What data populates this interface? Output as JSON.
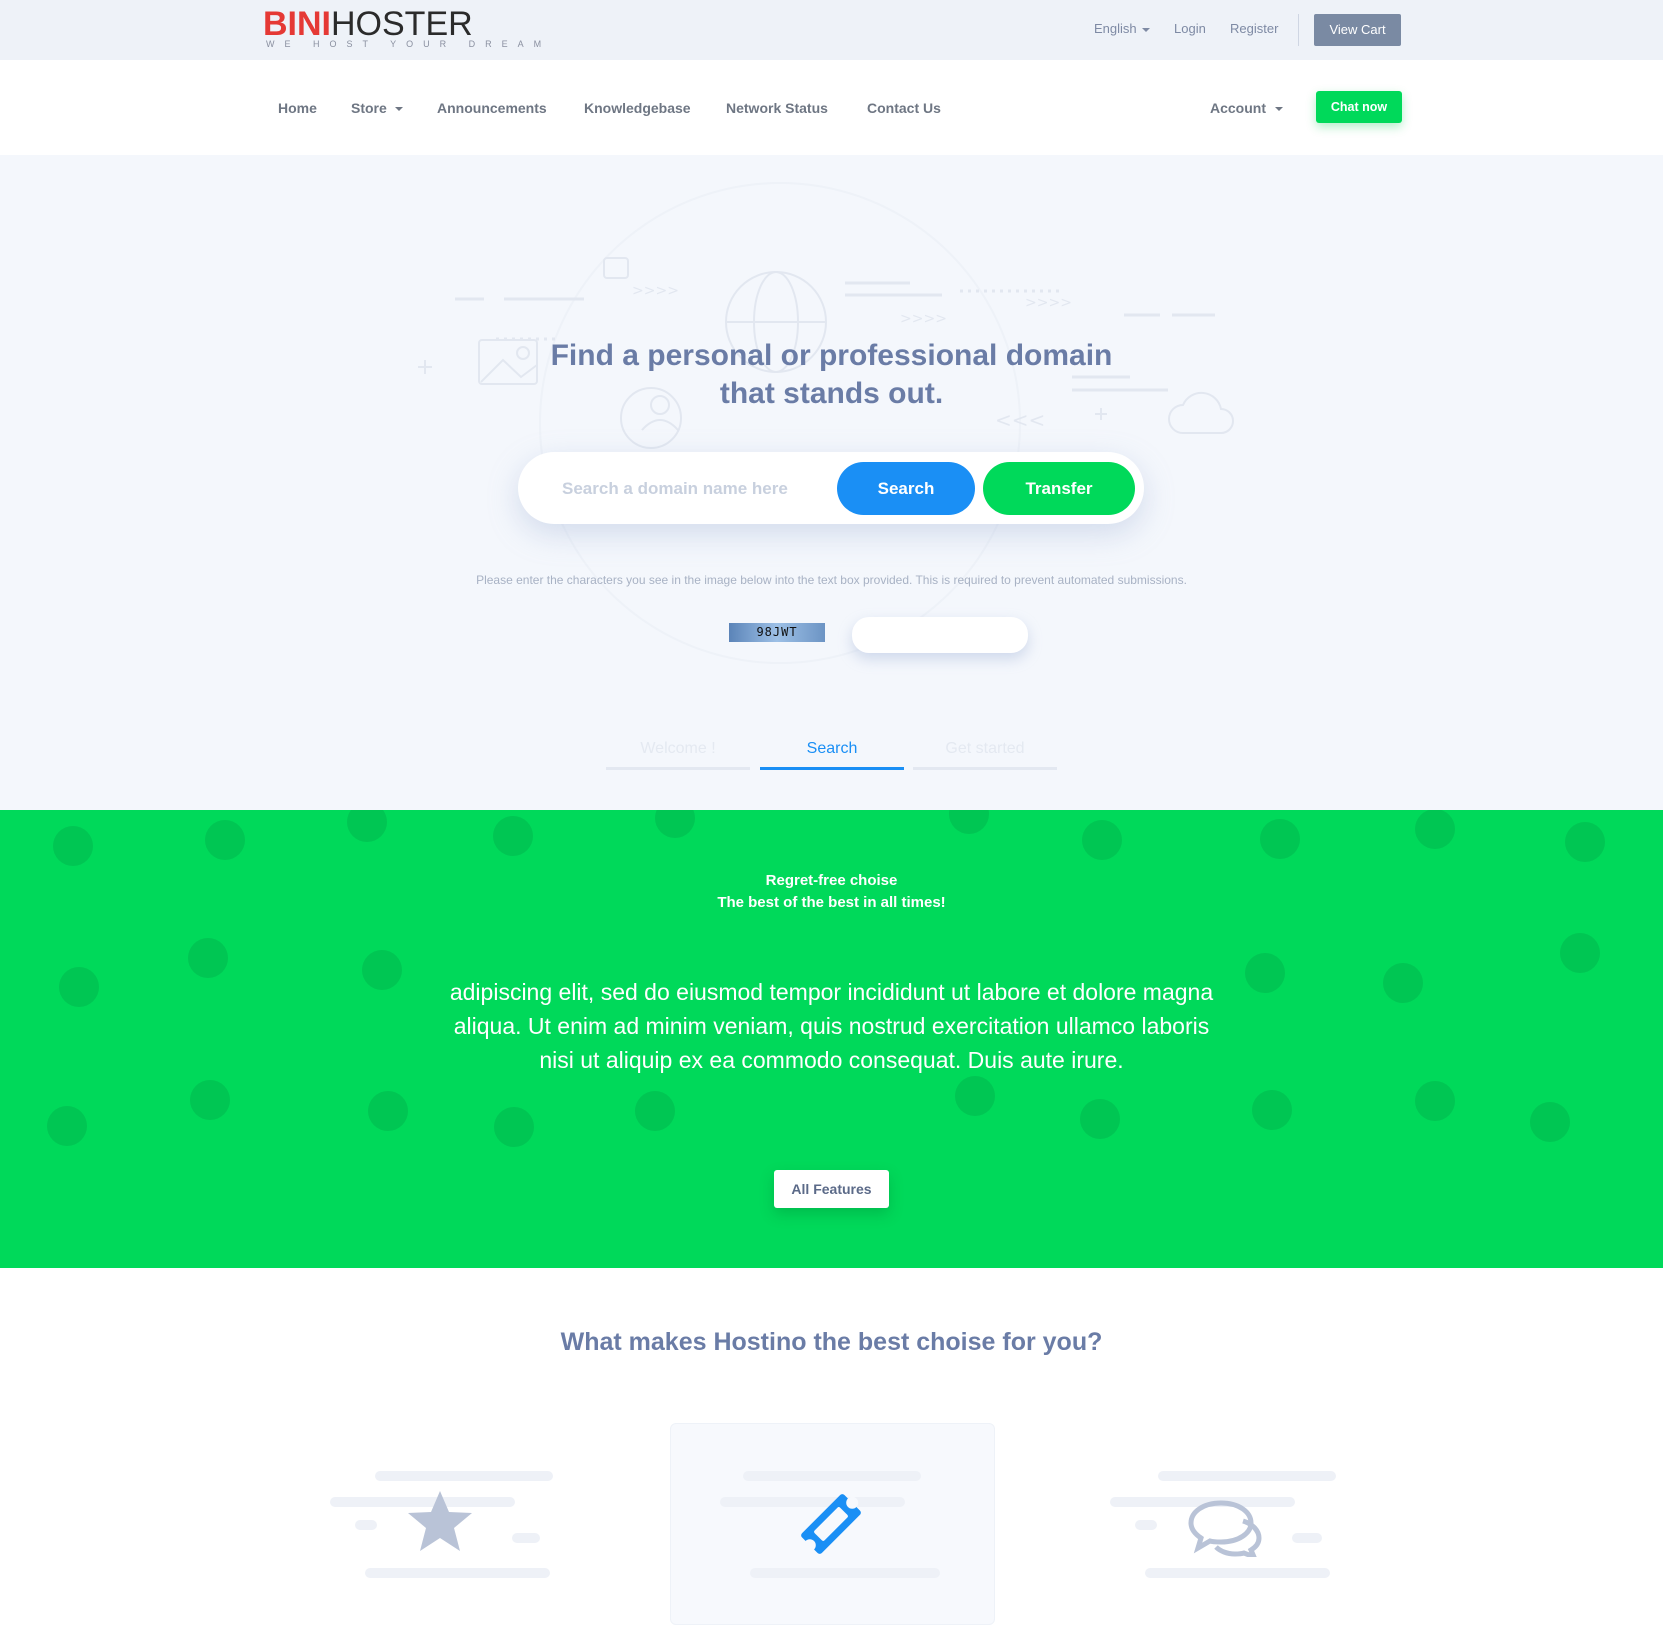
{
  "brand": {
    "logo_part1": "BINI",
    "logo_part2": "HOSTER",
    "tagline": "WE HOST YOUR DREAM"
  },
  "topbar": {
    "language": "English",
    "login": "Login",
    "register": "Register",
    "view_cart": "View Cart"
  },
  "nav": {
    "items": [
      "Home",
      "Store",
      "Announcements",
      "Knowledgebase",
      "Network Status",
      "Contact Us"
    ],
    "account": "Account",
    "chat_now": "Chat now"
  },
  "hero": {
    "title_line1": "Find a personal or professional domain",
    "title_line2": "that stands out.",
    "search_placeholder": "Search a domain name here",
    "search_button": "Search",
    "transfer_button": "Transfer",
    "captcha_instructions": "Please enter the characters you see in the image below into the text box provided. This is required to prevent automated submissions.",
    "captcha_code": "98JWT",
    "tabs": [
      "Welcome !",
      "Search",
      "Get started"
    ],
    "active_tab": "Search"
  },
  "promo": {
    "heading_line1": "Regret-free choise",
    "heading_line2": "The best of the best in all times!",
    "body": "adipiscing elit, sed do eiusmod tempor incididunt ut labore et dolore magna aliqua. Ut enim ad minim veniam, quis nostrud exercitation ullamco laboris nisi ut aliquip ex ea commodo consequat. Duis aute irure.",
    "button": "All Features"
  },
  "features": {
    "title": "What makes Hostino the best choise for you?",
    "icons": [
      "star-icon",
      "ticket-icon",
      "chat-bubbles-icon"
    ]
  },
  "colors": {
    "green": "#00d95a",
    "blue": "#1a8ff5",
    "red": "#e53935",
    "slate": "#6a7ca6"
  }
}
